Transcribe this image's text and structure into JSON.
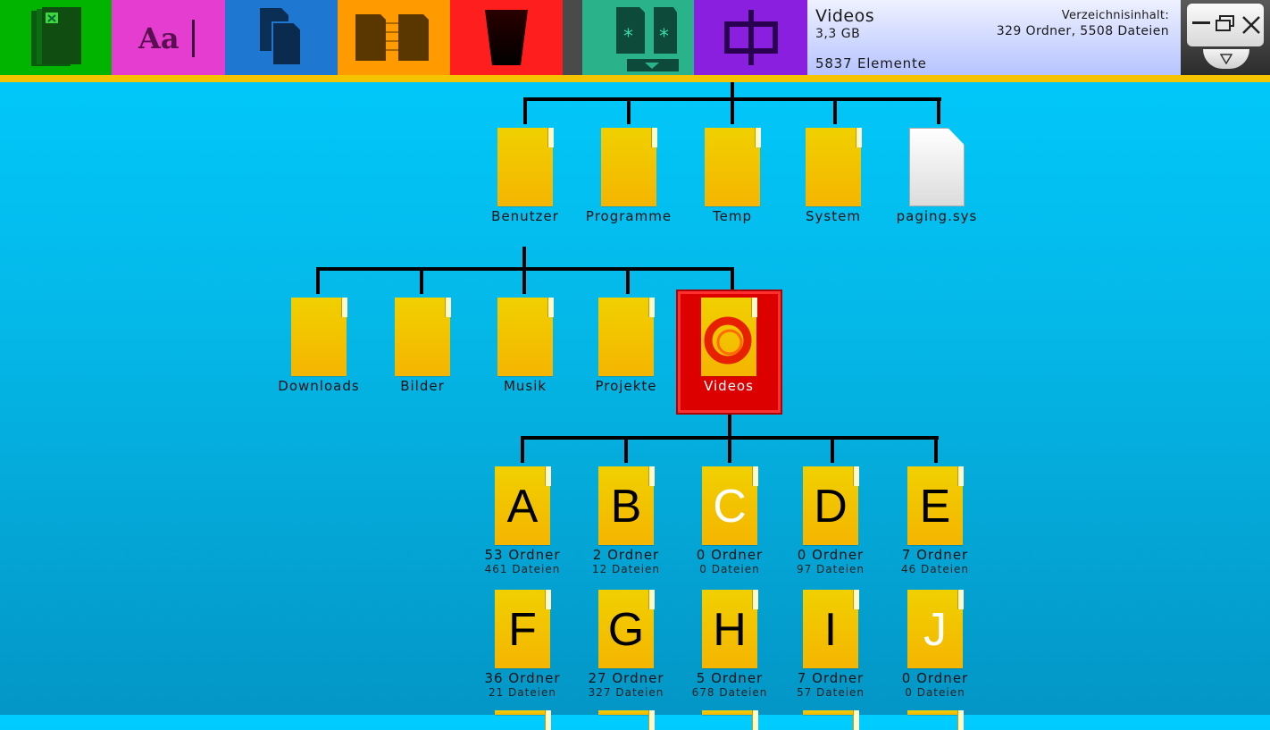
{
  "toolbar": {
    "buttons": [
      {
        "name": "excel-button",
        "color": "#00b400",
        "icon": "excel-icon"
      },
      {
        "name": "font-button",
        "color": "#e63dd1",
        "icon": "font-icon",
        "text": "Aa"
      },
      {
        "name": "copy-button",
        "color": "#1e78d2",
        "icon": "copy-icon"
      },
      {
        "name": "compare-button",
        "color": "#ff9a00",
        "icon": "compare-icon"
      },
      {
        "name": "delete-button",
        "color": "#ff1e1e",
        "icon": "trash-icon"
      },
      {
        "name": "archive-button",
        "color": "#2ab38a",
        "icon": "archive-icon"
      },
      {
        "name": "tree-view-button",
        "color": "#8a1fe0",
        "icon": "tree-icon"
      }
    ],
    "info": {
      "title": "Videos",
      "size": "3,3 GB",
      "count": "5837 Elemente",
      "contents_label": "Verzeichnisinhalt:",
      "contents_summary": "329 Ordner, 5508 Dateien"
    }
  },
  "tree": {
    "level1": [
      {
        "label": "Benutzer",
        "type": "folder"
      },
      {
        "label": "Programme",
        "type": "folder"
      },
      {
        "label": "Temp",
        "type": "folder"
      },
      {
        "label": "System",
        "type": "folder"
      },
      {
        "label": "paging.sys",
        "type": "file"
      }
    ],
    "level2": [
      {
        "label": "Downloads",
        "type": "folder"
      },
      {
        "label": "Bilder",
        "type": "folder"
      },
      {
        "label": "Musik",
        "type": "folder"
      },
      {
        "label": "Projekte",
        "type": "folder"
      },
      {
        "label": "Videos",
        "type": "folder",
        "selected": true
      }
    ],
    "level3_row1": [
      {
        "letter": "A",
        "folders": "53 Ordner",
        "files": "461 Dateien"
      },
      {
        "letter": "B",
        "folders": "2 Ordner",
        "files": "12 Dateien"
      },
      {
        "letter": "C",
        "folders": "0 Ordner",
        "files": "0 Dateien",
        "white": true
      },
      {
        "letter": "D",
        "folders": "0 Ordner",
        "files": "97 Dateien"
      },
      {
        "letter": "E",
        "folders": "7 Ordner",
        "files": "46 Dateien"
      }
    ],
    "level3_row2": [
      {
        "letter": "F",
        "folders": "36 Ordner",
        "files": "21 Dateien"
      },
      {
        "letter": "G",
        "folders": "27 Ordner",
        "files": "327 Dateien"
      },
      {
        "letter": "H",
        "folders": "5 Ordner",
        "files": "678 Dateien"
      },
      {
        "letter": "I",
        "folders": "7 Ordner",
        "files": "57 Dateien"
      },
      {
        "letter": "J",
        "folders": "0 Ordner",
        "files": "0 Dateien",
        "white": true
      }
    ]
  }
}
